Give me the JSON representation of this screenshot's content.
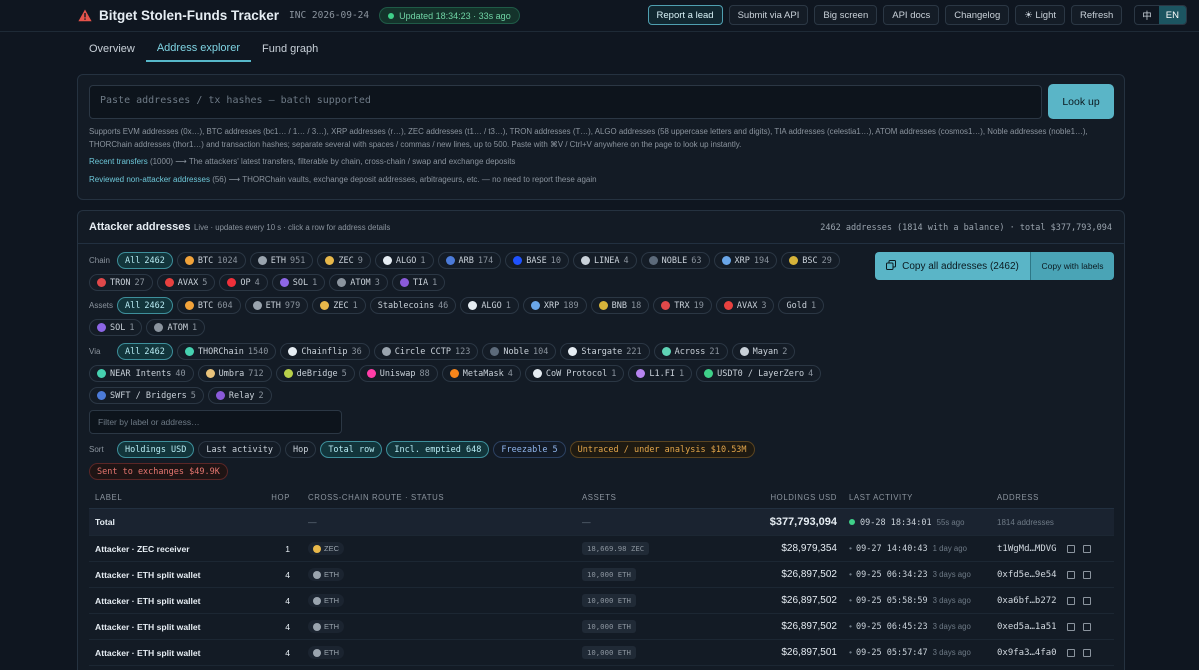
{
  "header": {
    "title": "Bitget Stolen-Funds Tracker",
    "incident": "INC 2026-09-24",
    "updated": "Updated 18:34:23 · 33s ago",
    "actions": [
      "Report a lead",
      "Submit via API",
      "Big screen",
      "API docs",
      "Changelog",
      "☀ Light",
      "Refresh"
    ],
    "lang": [
      "中",
      "EN"
    ]
  },
  "tabs": [
    "Overview",
    "Address explorer",
    "Fund graph"
  ],
  "lookup": {
    "placeholder": "Paste addresses / tx hashes — batch supported",
    "button": "Look up",
    "help_line1": "Supports EVM addresses (0x…), BTC addresses (bc1… / 1… / 3…), XRP addresses (r…), ZEC addresses (t1… / t3…), TRON addresses (T…), ALGO addresses (58 uppercase letters and digits), TIA addresses (celestia1…), ATOM addresses (cosmos1…), Noble addresses (noble1…),",
    "help_line2": "THORChain addresses (thor1…) and transaction hashes; separate several with spaces / commas / new lines, up to 500. Paste with ⌘V / Ctrl+V anywhere on the page to look up instantly.",
    "recent_link": "Recent transfers",
    "recent_count": "(1000) ⟶",
    "recent_desc": "The attackers' latest transfers, filterable by chain, cross-chain / swap and exchange deposits",
    "reviewed_link": "Reviewed non-attacker addresses",
    "reviewed_count": "(56) ⟶",
    "reviewed_desc": "THORChain vaults, exchange deposit addresses, arbitrageurs, etc. — no need to report these again"
  },
  "attackers": {
    "title": "Attacker addresses",
    "subtitle": "Live · updates every 10 s · click a row for address details",
    "summary": "2462 addresses (1814 with a balance) · total $377,793,094",
    "copy_all": "Copy all addresses (2462)",
    "copy_labels": "Copy with labels",
    "filter_placeholder": "Filter by label or address…",
    "chain_label": "Chain",
    "assets_label": "Assets",
    "via_label": "Via",
    "sort_label": "Sort",
    "chain_chips": [
      {
        "name": "All",
        "count": "2462",
        "active": true,
        "color": ""
      },
      {
        "name": "BTC",
        "count": "1024",
        "color": "#f2a33a"
      },
      {
        "name": "ETH",
        "count": "951",
        "color": "#9aa4ae"
      },
      {
        "name": "ZEC",
        "count": "9",
        "color": "#e8b84a"
      },
      {
        "name": "ALGO",
        "count": "1",
        "color": "#e6edf3"
      },
      {
        "name": "ARB",
        "count": "174",
        "color": "#4c7bd9"
      },
      {
        "name": "BASE",
        "count": "10",
        "color": "#1f52ff"
      },
      {
        "name": "LINEA",
        "count": "4",
        "color": "#c9d1d9"
      },
      {
        "name": "NOBLE",
        "count": "63",
        "color": "#5c6a7a"
      },
      {
        "name": "XRP",
        "count": "194",
        "color": "#6aa6e8"
      },
      {
        "name": "BSC",
        "count": "29",
        "color": "#d7b43a"
      },
      {
        "name": "TRON",
        "count": "27",
        "color": "#e0484a"
      },
      {
        "name": "AVAX",
        "count": "5",
        "color": "#e8413f"
      },
      {
        "name": "OP",
        "count": "4",
        "color": "#f0303a"
      },
      {
        "name": "SOL",
        "count": "1",
        "color": "#8d66e6"
      },
      {
        "name": "ATOM",
        "count": "3",
        "color": "#8b949e"
      },
      {
        "name": "TIA",
        "count": "1",
        "color": "#8a5ad9"
      }
    ],
    "asset_chips": [
      {
        "name": "All",
        "count": "2462",
        "active": true,
        "color": ""
      },
      {
        "name": "BTC",
        "count": "604",
        "color": "#f2a33a"
      },
      {
        "name": "ETH",
        "count": "979",
        "color": "#9aa4ae"
      },
      {
        "name": "ZEC",
        "count": "1",
        "color": "#e8b84a"
      },
      {
        "name": "Stablecoins",
        "count": "46",
        "color": ""
      },
      {
        "name": "ALGO",
        "count": "1",
        "color": "#e6edf3"
      },
      {
        "name": "XRP",
        "count": "189",
        "color": "#6aa6e8"
      },
      {
        "name": "BNB",
        "count": "18",
        "color": "#d7b43a"
      },
      {
        "name": "TRX",
        "count": "19",
        "color": "#e0484a"
      },
      {
        "name": "AVAX",
        "count": "3",
        "color": "#e8413f"
      },
      {
        "name": "Gold",
        "count": "1",
        "color": ""
      },
      {
        "name": "SOL",
        "count": "1",
        "color": "#8d66e6"
      },
      {
        "name": "ATOM",
        "count": "1",
        "color": "#8b949e"
      }
    ],
    "via_chips": [
      {
        "name": "All",
        "count": "2462",
        "active": true,
        "color": ""
      },
      {
        "name": "THORChain",
        "count": "1540",
        "color": "#46d1b0"
      },
      {
        "name": "Chainflip",
        "count": "36",
        "color": "#e6edf3"
      },
      {
        "name": "Circle CCTP",
        "count": "123",
        "color": "#9aa4ae"
      },
      {
        "name": "Noble",
        "count": "104",
        "color": "#5c6a7a"
      },
      {
        "name": "Stargate",
        "count": "221",
        "color": "#e6edf3"
      },
      {
        "name": "Across",
        "count": "21",
        "color": "#5fd3b5"
      },
      {
        "name": "Mayan",
        "count": "2",
        "color": "#c9d1d9"
      },
      {
        "name": "NEAR Intents",
        "count": "40",
        "color": "#46d1b0"
      },
      {
        "name": "Umbra",
        "count": "712",
        "color": "#e8c27a"
      },
      {
        "name": "deBridge",
        "count": "5",
        "color": "#b8d04a"
      },
      {
        "name": "Uniswap",
        "count": "88",
        "color": "#ff3da8"
      },
      {
        "name": "MetaMask",
        "count": "4",
        "color": "#f6851b"
      },
      {
        "name": "CoW Protocol",
        "count": "1",
        "color": "#e6edf3"
      },
      {
        "name": "L1.FI",
        "count": "1",
        "color": "#b784f0"
      },
      {
        "name": "USDT0 / LayerZero",
        "count": "4",
        "color": "#3fd089"
      },
      {
        "name": "SWFT / Bridgers",
        "count": "5",
        "color": "#4c7bd9"
      },
      {
        "name": "Relay",
        "count": "2",
        "color": "#8a5ad9"
      }
    ],
    "sort_chips": [
      {
        "name": "Holdings USD",
        "style": "active"
      },
      {
        "name": "Last activity",
        "style": ""
      },
      {
        "name": "Hop",
        "style": ""
      },
      {
        "name": "Total row",
        "style": "active"
      },
      {
        "name": "Incl. emptied 648",
        "style": "active"
      },
      {
        "name": "Freezable 5",
        "style": "blue"
      },
      {
        "name": "Untraced / under analysis $10.53M",
        "style": "orange"
      },
      {
        "name": "Sent to exchanges $49.9K",
        "style": "red"
      }
    ],
    "table": {
      "headers": [
        "LABEL",
        "HOP",
        "CROSS-CHAIN ROUTE · STATUS",
        "ASSETS",
        "HOLDINGS USD",
        "LAST ACTIVITY",
        "ADDRESS"
      ],
      "total": {
        "label": "Total",
        "route": "—",
        "assets": "—",
        "holdings": "$377,793,094",
        "activity": "09-28 18:34:01",
        "ago": "55s ago",
        "address": "1814 addresses"
      },
      "rows": [
        {
          "label": "Attacker · ZEC receiver",
          "hop": "1",
          "route": "ZEC",
          "route_color": "#e8b84a",
          "assets": "18,669.98 ZEC",
          "holdings": "$28,979,354",
          "activity": "09-27 14:40:43",
          "ago": "1 day ago",
          "address": "t1WgMd…MDVG"
        },
        {
          "label": "Attacker · ETH split wallet",
          "hop": "4",
          "route": "ETH",
          "route_color": "#9aa4ae",
          "assets": "10,000 ETH",
          "holdings": "$26,897,502",
          "activity": "09-25 06:34:23",
          "ago": "3 days ago",
          "address": "0xfd5e…9e54"
        },
        {
          "label": "Attacker · ETH split wallet",
          "hop": "4",
          "route": "ETH",
          "route_color": "#9aa4ae",
          "assets": "10,000 ETH",
          "holdings": "$26,897,502",
          "activity": "09-25 05:58:59",
          "ago": "3 days ago",
          "address": "0xa6bf…b272"
        },
        {
          "label": "Attacker · ETH split wallet",
          "hop": "4",
          "route": "ETH",
          "route_color": "#9aa4ae",
          "assets": "10,000 ETH",
          "holdings": "$26,897,502",
          "activity": "09-25 06:45:23",
          "ago": "3 days ago",
          "address": "0xed5a…1a51"
        },
        {
          "label": "Attacker · ETH split wallet",
          "hop": "4",
          "route": "ETH",
          "route_color": "#9aa4ae",
          "assets": "10,000 ETH",
          "holdings": "$26,897,501",
          "activity": "09-25 05:57:47",
          "ago": "3 days ago",
          "address": "0x9fa3…4fa0"
        }
      ]
    }
  },
  "colors": {
    "accent": "#5ab5c7",
    "bg": "#0f1620",
    "panel": "#131b25",
    "ok": "#3fd089",
    "warn": "#e5534b"
  }
}
